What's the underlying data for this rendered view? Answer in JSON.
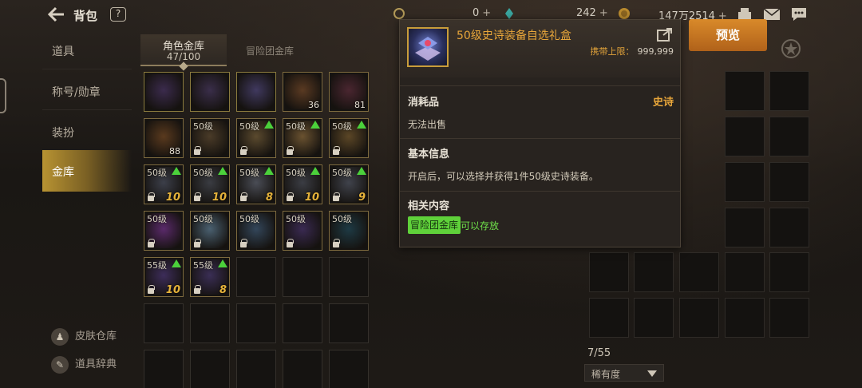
{
  "topbar": {
    "title": "背包",
    "help": "?",
    "currency1": "0",
    "currency2": "242",
    "currency3": "147万2514",
    "plus": "+"
  },
  "sidebar": {
    "items": [
      {
        "label": "道具"
      },
      {
        "label": "称号/勋章"
      },
      {
        "label": "装扮"
      },
      {
        "label": "金库"
      }
    ],
    "skin_storage": "皮肤仓库",
    "item_dictionary": "道具辞典"
  },
  "tabs": {
    "character_vault": "角色金库",
    "character_vault_count": "47/100",
    "adventure_vault": "冒险团金库"
  },
  "items": [
    {
      "count": "",
      "lvl": "",
      "art": "#3b2b4d",
      "epic": true
    },
    {
      "count": "",
      "lvl": "",
      "art": "#3a2e4a",
      "epic": true
    },
    {
      "count": "",
      "lvl": "",
      "art": "#40395f",
      "epic": true
    },
    {
      "count": "36",
      "lvl": "",
      "art": "#5a3a22",
      "epic": false
    },
    {
      "count": "81",
      "lvl": "",
      "art": "#4a2630",
      "epic": false
    },
    {
      "count": "88",
      "lvl": "",
      "art": "#5a3a1e",
      "epic": false
    },
    {
      "count": "",
      "lvl": "50级",
      "art": "#4a3b28",
      "epic": false
    },
    {
      "count": "",
      "lvl": "50级",
      "art": "#5b4a2e",
      "epic": false,
      "up": true
    },
    {
      "count": "",
      "lvl": "50级",
      "art": "#6a5230",
      "epic": false,
      "up": true
    },
    {
      "count": "",
      "lvl": "50级",
      "art": "#5b4626",
      "epic": false,
      "up": true
    },
    {
      "count": "",
      "lvl": "50级",
      "art": "#3c3f4a",
      "epic": false,
      "up": true,
      "enh": "10"
    },
    {
      "count": "",
      "lvl": "50级",
      "art": "#3a3c42",
      "epic": false,
      "up": true,
      "enh": "10"
    },
    {
      "count": "",
      "lvl": "50级",
      "art": "#4a4d56",
      "epic": false,
      "up": true,
      "enh": "8"
    },
    {
      "count": "",
      "lvl": "50级",
      "art": "#3b3d44",
      "epic": false,
      "up": true,
      "enh": "10"
    },
    {
      "count": "",
      "lvl": "50级",
      "art": "#40434c",
      "epic": false,
      "up": true,
      "enh": "9"
    },
    {
      "count": "",
      "lvl": "50级",
      "art": "#5a2a6a",
      "epic": false
    },
    {
      "count": "",
      "lvl": "50级",
      "art": "#4a6070",
      "epic": false
    },
    {
      "count": "",
      "lvl": "50级",
      "art": "#33465a",
      "epic": false
    },
    {
      "count": "",
      "lvl": "50级",
      "art": "#3a2a52",
      "epic": false
    },
    {
      "count": "",
      "lvl": "50级",
      "art": "#1e3a44",
      "epic": false
    },
    {
      "count": "",
      "lvl": "55级",
      "art": "#3d2d5a",
      "epic": false,
      "up": true,
      "enh": "10"
    },
    {
      "count": "",
      "lvl": "55级",
      "art": "#3a2e55",
      "epic": false,
      "up": true,
      "enh": "8"
    }
  ],
  "right_panel": {
    "count": "7/55",
    "sort_label": "稀有度"
  },
  "preview_button": "预览",
  "tooltip": {
    "name": "50级史诗装备自选礼盒",
    "carry_label": "携带上限：",
    "carry_value": "999,999",
    "category": "消耗品",
    "rarity": "史诗",
    "sell": "无法出售",
    "basic_info_title": "基本信息",
    "basic_info_text": "开启后，可以选择并获得1件50级史诗装备。",
    "related_title": "相关内容",
    "related_tag": "冒险团金库",
    "related_desc": "可以存放"
  },
  "colors": {
    "epic": "#e8a63a",
    "accent_gold": "#b89332",
    "green": "#5fd13a",
    "preview_btn": "#c97624"
  }
}
